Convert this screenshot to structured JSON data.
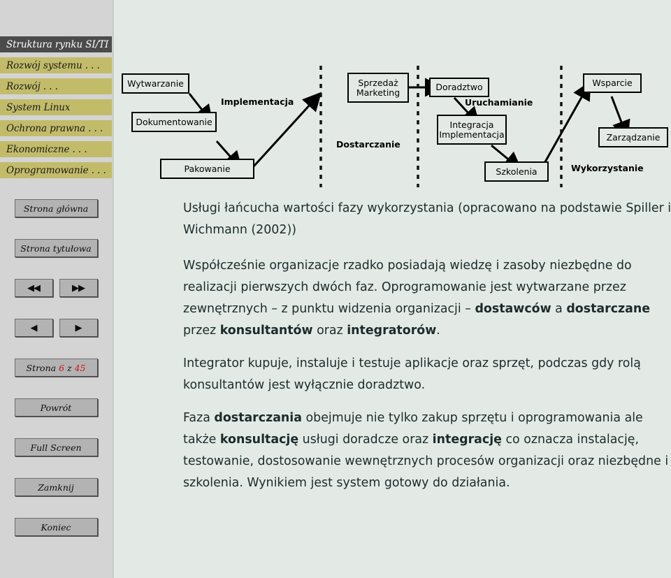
{
  "colors": {
    "page_background": "#e3eae6",
    "sidebar_background": "#d4d4d4",
    "toc_item": "#c2bc6a",
    "toc_current": "#4b4b4b",
    "button_face": "#b3b3b3",
    "page_number_accent": "#d01414"
  },
  "sidebar": {
    "toc": [
      {
        "label": "Struktura rynku SI/TI",
        "current": true
      },
      {
        "label": "Rozwój systemu . . .",
        "current": false
      },
      {
        "label": "Rozwój . . .",
        "current": false
      },
      {
        "label": "System Linux",
        "current": false
      },
      {
        "label": "Ochrona prawna . . .",
        "current": false
      },
      {
        "label": "Ekonomiczne . . .",
        "current": false
      },
      {
        "label": "Oprogramowanie . . .",
        "current": false
      }
    ],
    "nav": {
      "home_label": "Strona główna",
      "title_page_label": "Strona tytułowa",
      "first_label": "◀◀",
      "last_label": "▶▶",
      "prev_label": "◀",
      "next_label": "▶",
      "page_prefix": "Strona",
      "page_current": "6",
      "page_of": "z",
      "page_total": "45",
      "back_label": "Powrót",
      "fullscreen_label": "Full Screen",
      "close_label": "Zamknij",
      "quit_label": "Koniec"
    }
  },
  "diagram": {
    "boxes": [
      {
        "id": "wytwarzanie",
        "label": "Wytwarzanie"
      },
      {
        "id": "dokumentowanie",
        "label": "Dokumentowanie"
      },
      {
        "id": "pakowanie",
        "label": "Pakowanie"
      },
      {
        "id": "sprzedaz-marketing",
        "label": "Sprzedaż\nMarketing"
      },
      {
        "id": "doradztwo",
        "label": "Doradztwo"
      },
      {
        "id": "integracja-implementacja",
        "label": "Integracja\nImplementacja"
      },
      {
        "id": "szkolenia",
        "label": "Szkolenia"
      },
      {
        "id": "wsparcie",
        "label": "Wsparcie"
      },
      {
        "id": "zarzadzanie",
        "label": "Zarządzanie"
      }
    ],
    "phase_labels": [
      {
        "id": "implementacja",
        "label": "Implementacja"
      },
      {
        "id": "dostarczanie",
        "label": "Dostarczanie"
      },
      {
        "id": "uruchamianie",
        "label": "Uruchamianie"
      },
      {
        "id": "wykorzystanie",
        "label": "Wykorzystanie"
      }
    ]
  },
  "content": {
    "caption": "Usługi łańcucha wartości fazy wykorzystania (opracowano na podstawie Spiller i Wichmann (2002))",
    "paragraph2": {
      "part1": "Współcześnie organizacje rzadko posiadają wiedzę i zasoby niezbędne do realizacji pierwszych dwóch faz. Oprogramowanie jest wytwarzane przez zewnętrznych – z punktu widzenia organizacji – ",
      "bold1": "dostawców",
      "part2": " a ",
      "bold2": "dostarczane",
      "part3": " przez ",
      "bold3": "konsultantów",
      "part4": " oraz ",
      "bold4": "integratorów",
      "part5": "."
    },
    "paragraph3": "Integrator kupuje, instaluje i testuje aplikacje oraz sprzęt, podczas gdy rolą konsultantów jest wyłącznie doradztwo.",
    "paragraph4": {
      "part1": "Faza ",
      "bold1": "dostarczania",
      "part2": " obejmuje nie tylko zakup sprzętu i oprogramowania ale także ",
      "bold2": "konsultację",
      "part3": " usługi doradcze oraz ",
      "bold3": "integrację",
      "part4": " co oznacza instalację, testowanie, dostosowanie wewnętrznych procesów organizacji oraz niezbędne i szkolenia. Wynikiem jest system gotowy do działania."
    }
  }
}
